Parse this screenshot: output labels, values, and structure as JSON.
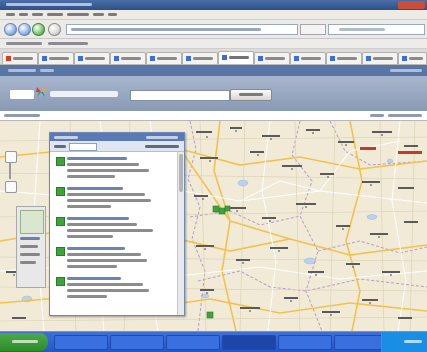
{
  "colors": {
    "title_bar": "#2e4f87",
    "app_bar": "#5875a6",
    "banner": "#8a9ab5",
    "map_background": "#f0ead7",
    "panel_header": "#5b79b4",
    "result_marker": "#3fa33c",
    "taskbar": "#2456c6",
    "start_button": "#2d8b2a"
  },
  "icons": {
    "back": "back-arrow-icon",
    "forward": "forward-arrow-icon",
    "refresh": "refresh-icon",
    "home": "home-icon",
    "logo": "msn-butterfly-icon",
    "result": "green-square-marker-icon",
    "start": "windows-start-icon"
  }
}
